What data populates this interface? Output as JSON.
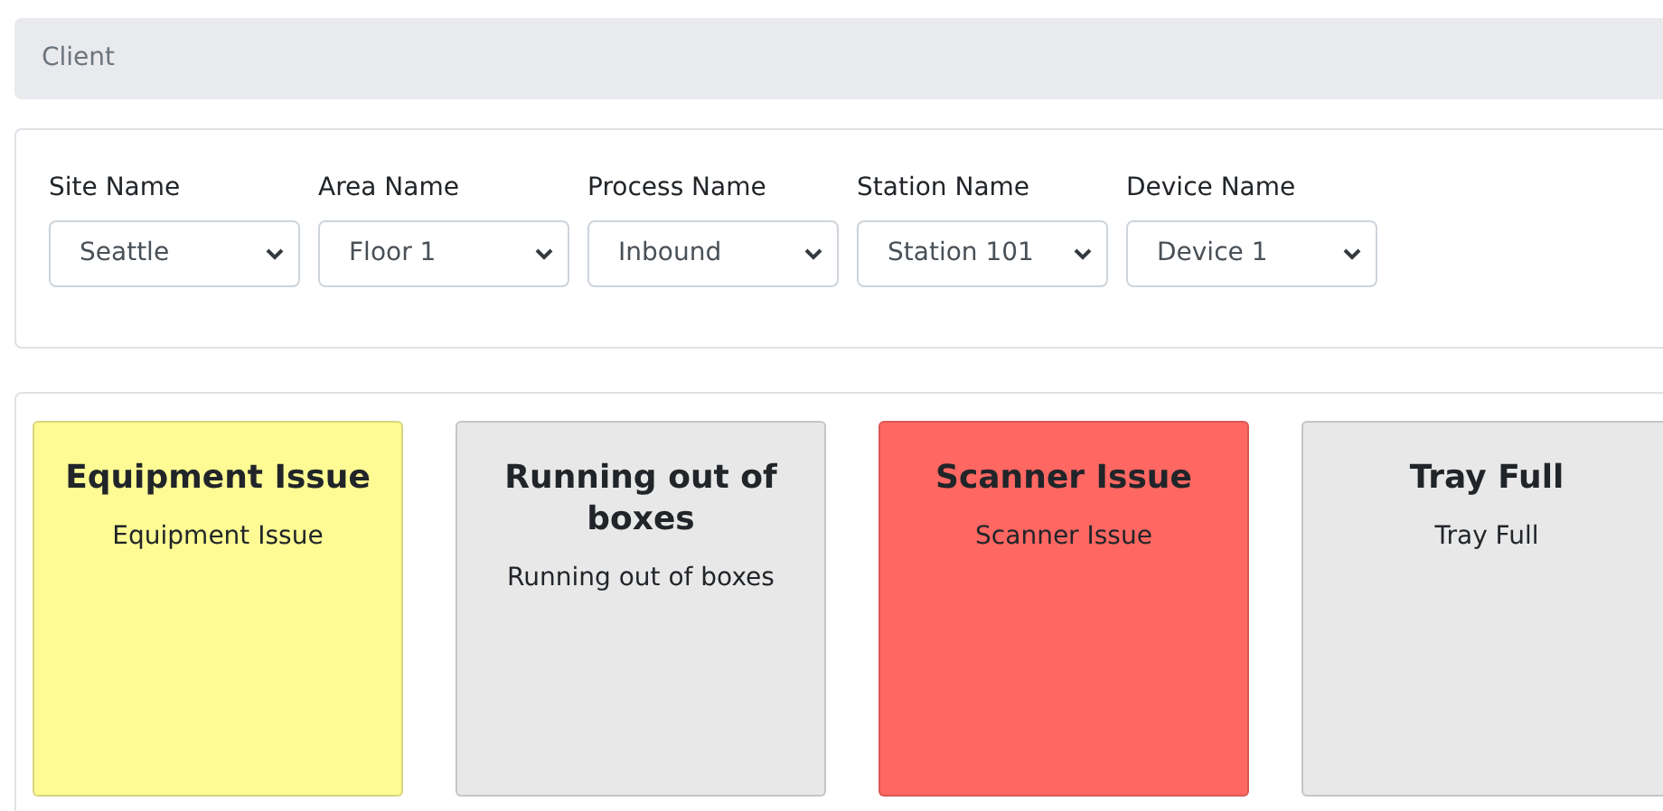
{
  "client_bar": {
    "label": "Client"
  },
  "filters": [
    {
      "label": "Site Name",
      "value": "Seattle"
    },
    {
      "label": "Area Name",
      "value": "Floor 1"
    },
    {
      "label": "Process Name",
      "value": "Inbound"
    },
    {
      "label": "Station Name",
      "value": "Station 101"
    },
    {
      "label": "Device Name",
      "value": "Device 1"
    }
  ],
  "issue_cards": [
    {
      "title": "Equipment Issue",
      "description": "Equipment Issue",
      "color": "#fffb94"
    },
    {
      "title": "Running out of boxes",
      "description": "Running out of boxes",
      "color": "#e8e8e8"
    },
    {
      "title": "Scanner Issue",
      "description": "Scanner Issue",
      "color": "#ff6762"
    },
    {
      "title": "Tray Full",
      "description": "Tray Full",
      "color": "#e8e8e8"
    }
  ]
}
